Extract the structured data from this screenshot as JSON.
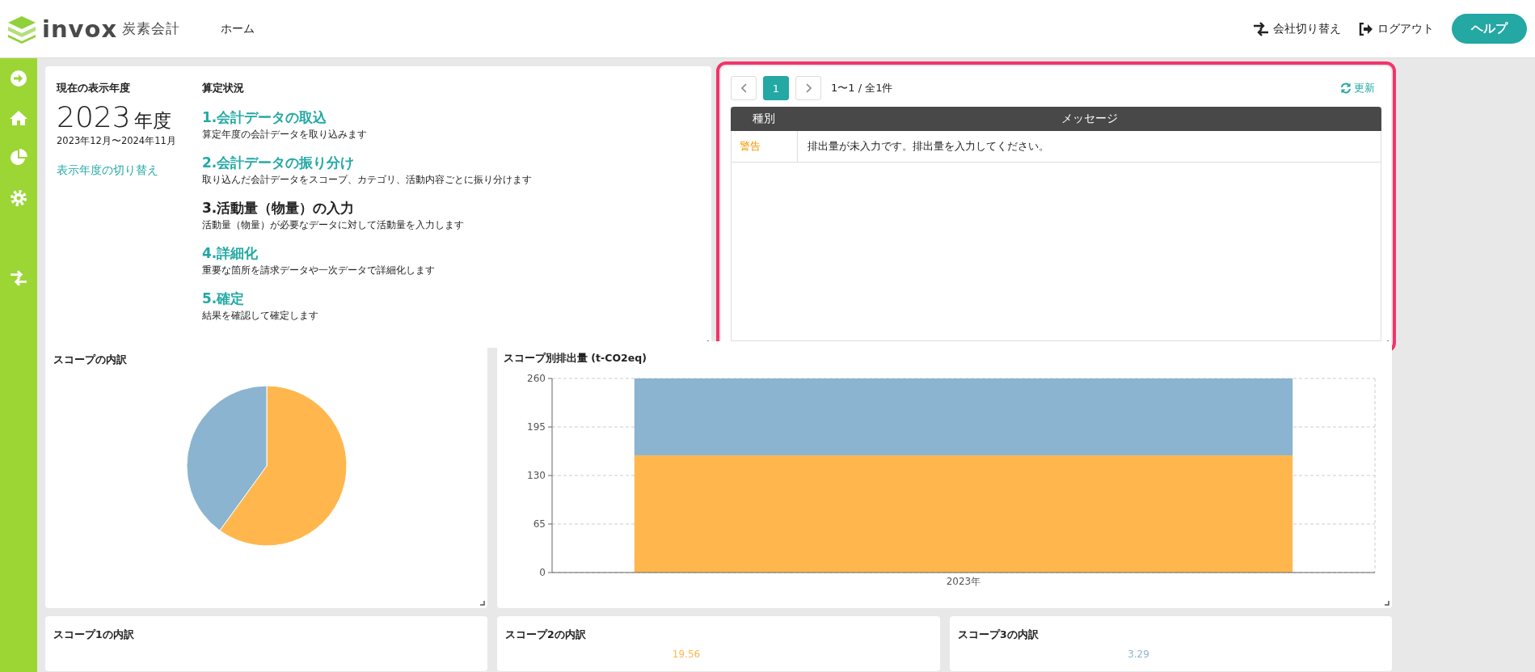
{
  "header": {
    "logo_text": "invox",
    "logo_subtitle": "炭素会計",
    "nav": [
      {
        "label": "ホーム"
      }
    ],
    "actions": [
      {
        "label": "会社切り替え"
      },
      {
        "label": "ログアウト"
      }
    ],
    "help_button": "ヘルプ"
  },
  "fiscal_year": {
    "label": "現在の表示年度",
    "year": "2023",
    "unit": "年度",
    "period": "2023年12月〜2024年11月",
    "switch_link": "表示年度の切り替え"
  },
  "calculation_status": {
    "title": "算定状況",
    "steps": [
      {
        "title": "1.会計データの取込",
        "description": "算定年度の会計データを取り込みます",
        "current": false
      },
      {
        "title": "2.会計データの振り分け",
        "description": "取り込んだ会計データをスコープ、カテゴリ、活動内容ごとに振り分けます",
        "current": false
      },
      {
        "title": "3.活動量（物量）の入力",
        "description": "活動量（物量）が必要なデータに対して活動量を入力します",
        "current": true
      },
      {
        "title": "4.詳細化",
        "description": "重要な箇所を請求データや一次データで詳細化します",
        "current": false
      },
      {
        "title": "5.確定",
        "description": "結果を確認して確定します",
        "current": false
      }
    ]
  },
  "messages": {
    "highlighted": true,
    "pages": [
      {
        "label": "1",
        "selected": true
      }
    ],
    "summary": "1〜1 / 全1件",
    "refresh": "更新",
    "columns": [
      "種別",
      "メッセージ"
    ],
    "rows": [
      {
        "type": "警告",
        "message": "排出量が未入力です。排出量を入力してください。"
      }
    ]
  },
  "scope_breakdown": {
    "title": "スコープの内訳"
  },
  "scope_emissions": {
    "title": "スコープ別排出量 (t-CO2eq)",
    "chart_data": {
      "type": "bar",
      "categories": [
        "2023年"
      ],
      "series": [
        {
          "color": "#ffb74d",
          "values": [
            157
          ]
        },
        {
          "color": "#8ab4d0",
          "values": [
            103
          ]
        }
      ],
      "ylim": [
        0,
        260
      ],
      "yticks": [
        0,
        65,
        130,
        195,
        260
      ],
      "stacked": true,
      "grid": true
    }
  },
  "scope_details": [
    {
      "title": "スコープ1の内訳"
    },
    {
      "title": "スコープ2の内訳",
      "value_label": "19.56",
      "color": "#ffb74d"
    },
    {
      "title": "スコープ3の内訳",
      "value_label": "3.29",
      "color": "#8ab4d0"
    }
  ]
}
